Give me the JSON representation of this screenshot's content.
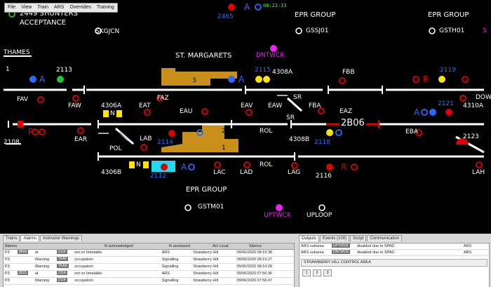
{
  "menu": [
    "File",
    "View",
    "Train",
    "ARS",
    "Overrides",
    "Training"
  ],
  "clock": "08:22:13",
  "labels": {
    "shunters": "2449 SHUNTERS",
    "acceptance": "ACCEPTANCE",
    "skgjcn": "SKGJCN",
    "thames": "THAMES",
    "one_left": "1",
    "st_margarets": "ST. MARGARETS",
    "epr1": "EPR GROUP",
    "epr2": "EPR GROUP",
    "epr3": "EPR GROUP",
    "gssj01": "GSSJ01",
    "gsth01": "GSTH01",
    "gstm01": "GSTM01",
    "dntwck": "DNTWCK",
    "uptwck": "UPTWCK",
    "uploop": "UPLOOP",
    "s_edge": "S",
    "fav": "FAV",
    "faw": "FAW",
    "faz": "FAZ",
    "eat": "EAT",
    "eau": "EAU",
    "eav": "EAV",
    "eaw": "EAW",
    "fba": "FBA",
    "fbb": "FBB",
    "eaz": "EAZ",
    "ear": "EAR",
    "pol": "POL",
    "lab": "LAB",
    "lac": "LAC",
    "lad": "LAD",
    "lag": "LAG",
    "lah": "LAH",
    "rol1": "ROL",
    "rol2": "ROL",
    "eba": "EBA",
    "sr1": "SR",
    "sr2": "SR",
    "dow": "DOW",
    "t4306a": "4306A",
    "t4306b": "4306B",
    "t4308a": "4308A",
    "t4308b": "4308B",
    "t4310a": "4310A",
    "plat3": "3",
    "plat2": "2",
    "plat1": "1",
    "n1": "N",
    "n2": "N",
    "a1": "A",
    "a2": "A",
    "a3": "A",
    "a4": "A",
    "a5": "A",
    "r1": "R",
    "r2": "R",
    "r3": "R",
    "headcode": "2B06"
  },
  "train_ids": {
    "t2465": "2465",
    "t2113": "2113",
    "t2115": "2115",
    "t2119": "2119",
    "t2121": "2121",
    "t2114": "2114",
    "t2118": "2118",
    "t2108": "2108",
    "t2123": "2123",
    "t2112": "2112",
    "t2116": "2116"
  },
  "bottom": {
    "left_tabs": [
      "Trains",
      "Alarms",
      "Instructor Warnings"
    ],
    "right_tabs": [
      "Outputs",
      "Events (100)",
      "Script",
      "Communication"
    ],
    "columns": [
      "Alarms",
      "R acknowledged",
      "R uncleared",
      "Act Local",
      "Silence"
    ],
    "rows": [
      {
        "pri": "P3",
        "c1": "2B06",
        "at": "at",
        "c2": "2116",
        "msg": "not on timetable",
        "area": "ARS",
        "loc": "Strawberry Hill",
        "time": "09/06/2020 08:15:38"
      },
      {
        "pri": "P3",
        "c1": "",
        "at": "Warning",
        "c2": "TKAT",
        "msg": "occupation",
        "area": "Signalling",
        "loc": "Strawberry Hill",
        "time": "09/06/2020 08:15:27"
      },
      {
        "pri": "P3",
        "c1": "",
        "at": "Warning",
        "c2": "TKAK",
        "msg": "occupation",
        "area": "Signalling",
        "loc": "Strawberry Hill",
        "time": "09/06/2020 08:10:28"
      },
      {
        "pri": "P3",
        "c1": "2B21",
        "at": "at",
        "c2": "2114",
        "msg": "not on timetable",
        "area": "ARS",
        "loc": "Strawberry Hill",
        "time": "09/06/2020 07:56:36"
      },
      {
        "pri": "P3",
        "c1": "",
        "at": "Warning",
        "c2": "2114",
        "msg": "occupation",
        "area": "Signalling",
        "loc": "Strawberry Hill",
        "time": "09/06/2020 07:56:47"
      }
    ],
    "outputs": [
      {
        "a": "ARS subarea",
        "b": "UPTWCK",
        "c": "disabled due to SPAD",
        "d": "ARS"
      },
      {
        "a": "ARS subarea",
        "b": "DNTWCK",
        "c": "disabled due to SPAD",
        "d": "ARS"
      }
    ],
    "control_area": "STRAWBERRY HILL CONTROL AREA",
    "pages": [
      "1",
      "2",
      "3"
    ]
  },
  "colors": {
    "track": "#ffffff",
    "signal_red": "#e00000",
    "signal_blue": "#2a6cff",
    "amber": "#c8901b",
    "cyan": "#22d8ee",
    "yellow": "#ffe400",
    "magenta": "#ee22ee",
    "green": "#22c433"
  }
}
